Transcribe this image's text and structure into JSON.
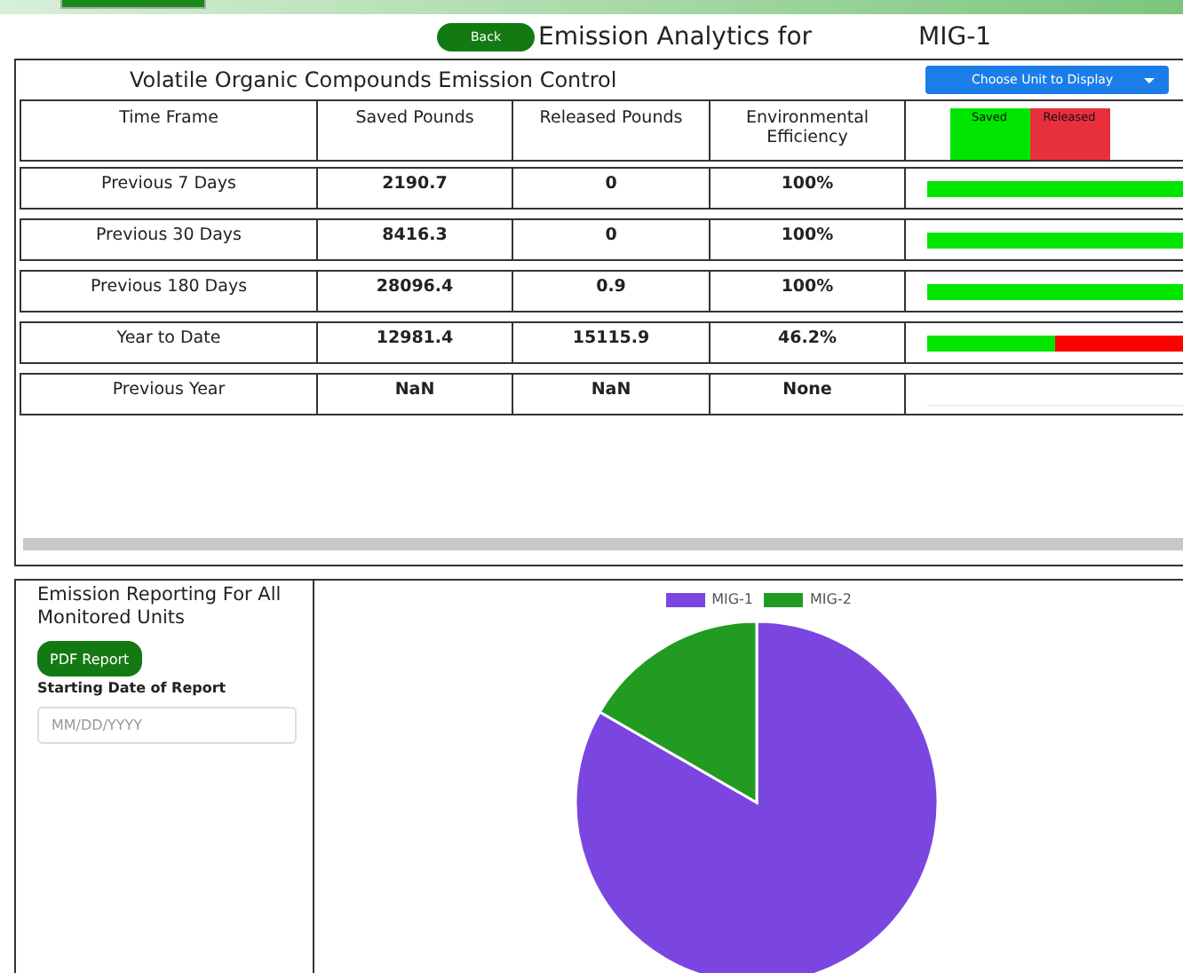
{
  "header": {
    "back_button": "Back",
    "title": "Emission Analytics for",
    "unit": "MIG-1"
  },
  "voc_panel": {
    "title": "Volatile Organic Compounds Emission Control",
    "unit_dropdown": "Choose Unit to Display",
    "columns": [
      "Time Frame",
      "Saved Pounds",
      "Released Pounds",
      "Environmental Efficiency"
    ],
    "legend": [
      {
        "label": "Saved",
        "color": "#00e600"
      },
      {
        "label": "Released",
        "color": "#e8303c"
      }
    ],
    "rows": [
      {
        "time_frame": "Previous 7 Days",
        "saved": "2190.7",
        "released": "0",
        "efficiency": "100%",
        "level": 1
      },
      {
        "time_frame": "Previous 30 Days",
        "saved": "8416.3",
        "released": "0",
        "efficiency": "100%",
        "level": 1
      },
      {
        "time_frame": "Previous 180 Days",
        "saved": "28096.4",
        "released": "0.9",
        "efficiency": "100%",
        "level": 1
      },
      {
        "time_frame": "Year to Date",
        "saved": "12981.4",
        "released": "15115.9",
        "efficiency": "46.2%",
        "level": 0.46
      },
      {
        "time_frame": "Previous Year",
        "saved": "NaN",
        "released": "NaN",
        "efficiency": "None"
      }
    ]
  },
  "report_panel": {
    "title": "Emission Reporting For All Monitored Units",
    "pdf_button": "PDF Report",
    "date_label": "Starting Date of Report",
    "date_field": {
      "placeholder": "MM/DD/YYYY"
    }
  },
  "pie_chart": {
    "legend": [
      {
        "label": "MIG-1",
        "color": "#7b46e0"
      },
      {
        "label": "MIG-2",
        "color": "#219b21"
      }
    ]
  }
}
